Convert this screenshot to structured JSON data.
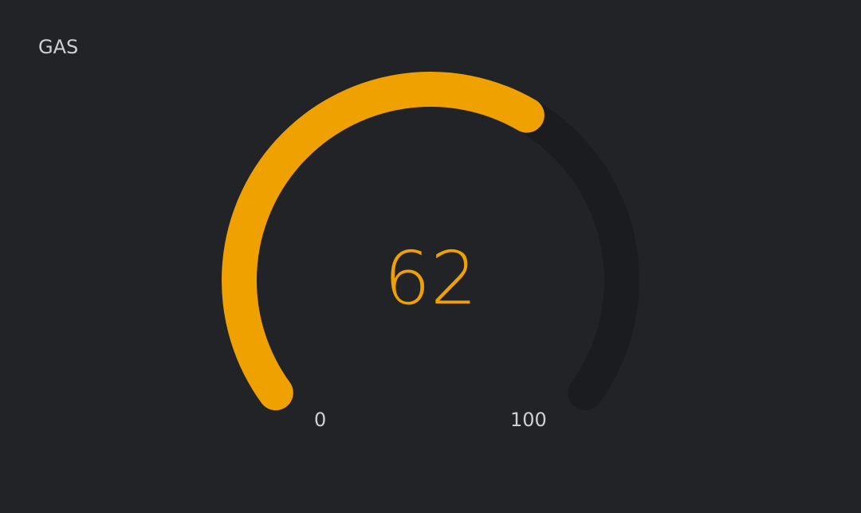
{
  "widget": {
    "title": "GAS",
    "value": "62",
    "min_label": "0",
    "max_label": "100"
  },
  "gauge": {
    "min": 0,
    "max": 100,
    "value": 62,
    "accent_color": "#efa100",
    "track_color": "#1b1c1f",
    "background_color": "#222327"
  }
}
